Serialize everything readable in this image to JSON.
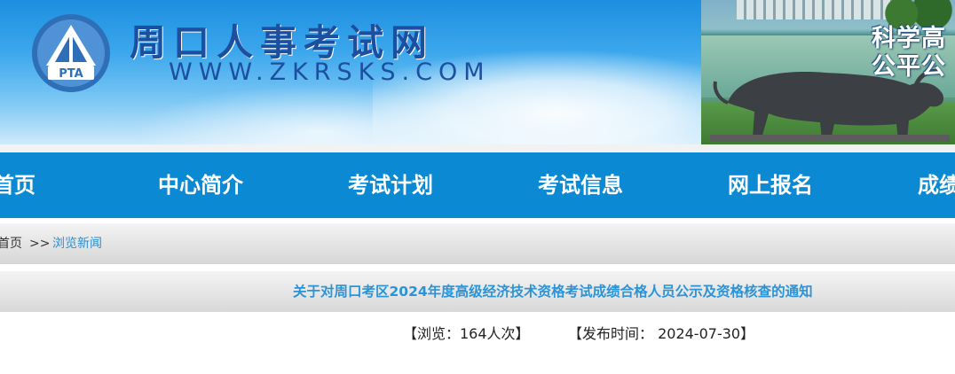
{
  "header": {
    "site_title": "周口人事考试网",
    "site_url": "WWW.ZKRSKS.COM",
    "logo_text": "PTA",
    "slogan_line1": "科学高",
    "slogan_line2": "公平公"
  },
  "nav": {
    "items": [
      {
        "label": "首页"
      },
      {
        "label": "中心简介"
      },
      {
        "label": "考试计划"
      },
      {
        "label": "考试信息"
      },
      {
        "label": "网上报名"
      },
      {
        "label": "成绩"
      }
    ]
  },
  "breadcrumb": {
    "home": "首页",
    "separator": ">>",
    "current": "浏览新闻"
  },
  "article": {
    "title": "关于对周口考区2024年度高级经济技术资格考试成绩合格人员公示及资格核查的通知",
    "views": "【浏览：164人次】",
    "publish_time": "【发布时间： 2024-07-30】"
  },
  "colors": {
    "nav_bg": "#0b8ad3",
    "title_blue": "#2b93d6",
    "brand_blue": "#1d4fa0"
  }
}
